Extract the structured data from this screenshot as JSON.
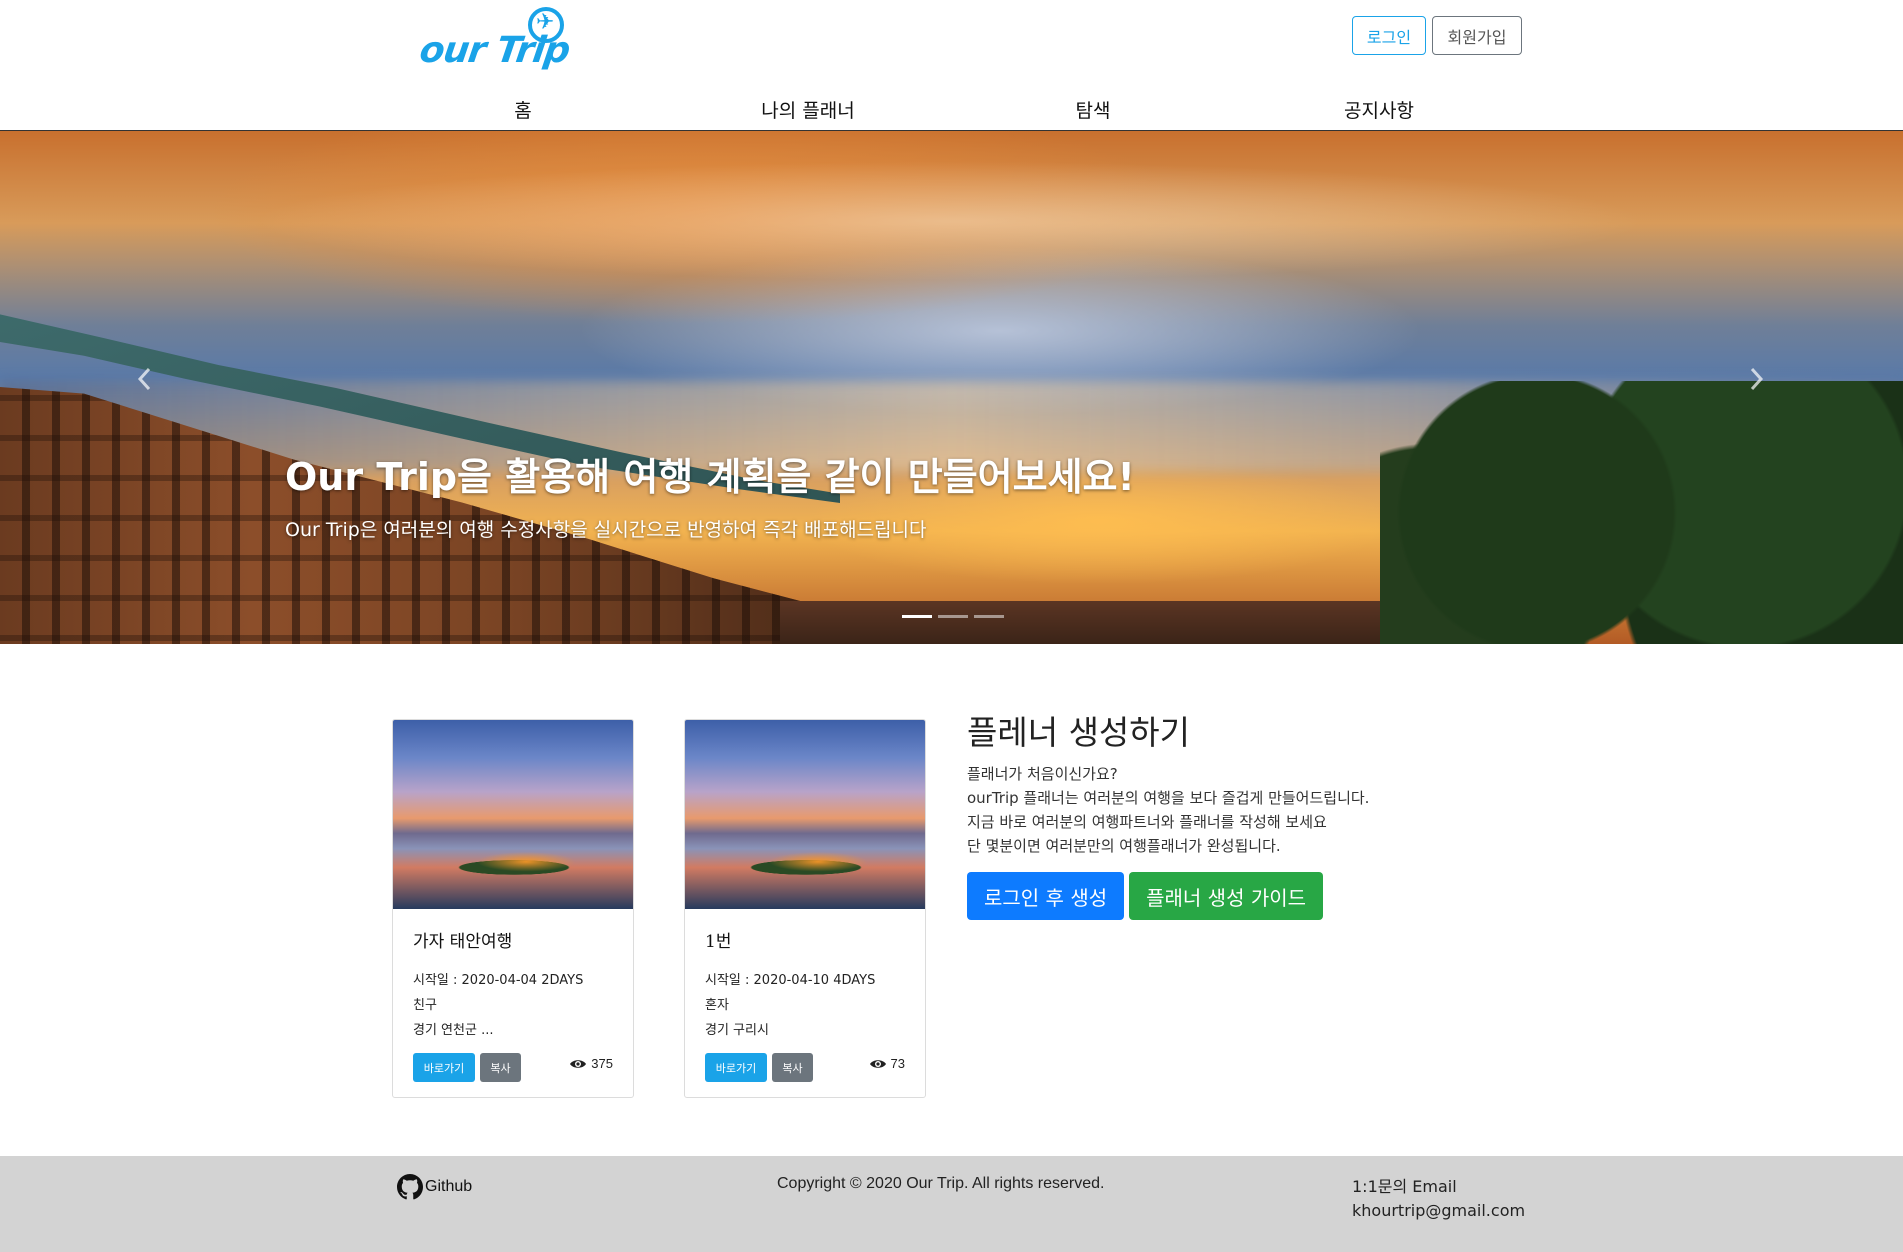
{
  "header": {
    "logo_text": "our Trip",
    "login_label": "로그인",
    "signup_label": "회원가입"
  },
  "nav": {
    "items": [
      {
        "label": "홈"
      },
      {
        "label": "나의 플래너"
      },
      {
        "label": "탐색"
      },
      {
        "label": "공지사항"
      }
    ]
  },
  "hero": {
    "title": "Our Trip을 활용해 여행 계획을 같이 만들어보세요!",
    "subtitle": "Our Trip은 여러분의 여행 수정사항을 실시간으로 반영하여 즉각 배포해드립니다",
    "prev_icon": "chevron-left",
    "next_icon": "chevron-right",
    "slide_count": 3,
    "active_slide": 1
  },
  "cards": [
    {
      "title": "가자 태안여행",
      "start": "시작일 : 2020-04-04 2DAYS",
      "companion": "친구",
      "location": "경기 연천군 ...",
      "go_label": "바로가기",
      "copy_label": "복사",
      "views": "375"
    },
    {
      "title": "1번",
      "start": "시작일 : 2020-04-10 4DAYS",
      "companion": "혼자",
      "location": "경기 구리시",
      "go_label": "바로가기",
      "copy_label": "복사",
      "views": "73"
    }
  ],
  "planner": {
    "title": "플레너 생성하기",
    "lines": [
      "플래너가 처음이신가요?",
      "ourTrip 플래너는 여러분의 여행을 보다 즐겁게 만들어드립니다.",
      "지금 바로 여러분의 여행파트너와 플래너를 작성해 보세요",
      "단 몇분이면 여러분만의 여행플래너가 완성됩니다."
    ],
    "primary_label": "로그인 후 생성",
    "guide_label": "플래너 생성 가이드"
  },
  "footer": {
    "github_label": "Github",
    "copyright": "Copyright © 2020 Our Trip. All rights reserved.",
    "contact_title": "1:1문의 Email",
    "contact_email": "khourtrip@gmail.com"
  },
  "colors": {
    "brand": "#1aa3e8",
    "primary": "#0d7bff",
    "success": "#28a745",
    "secondary": "#6c757d",
    "footer_bg": "#d3d3d3"
  }
}
